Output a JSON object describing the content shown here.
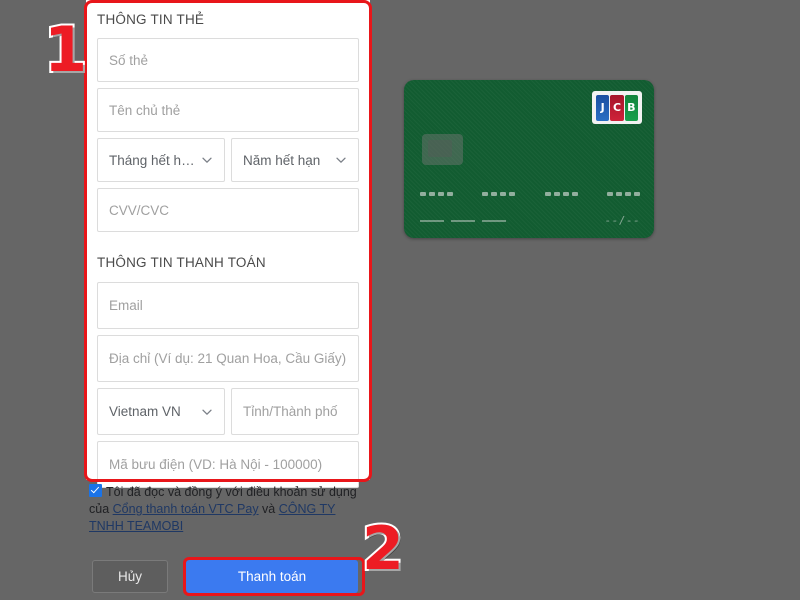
{
  "page": {
    "background_color": "#666666",
    "accent_blue": "#3b7af0",
    "annotation_red": "#e8161a"
  },
  "form": {
    "card_section_title": "THÔNG TIN THẺ",
    "payment_section_title": "THÔNG TIN THANH TOÁN",
    "card_number_placeholder": "Số thẻ",
    "card_holder_placeholder": "Tên chủ thẻ",
    "exp_month_label": "Tháng hết hạn",
    "exp_year_label": "Năm hết hạn",
    "cvv_placeholder": "CVV/CVC",
    "email_placeholder": "Email",
    "address_placeholder": "Địa chỉ (Ví dụ: 21 Quan Hoa, Cầu Giấy)",
    "country_label": "Vietnam VN",
    "city_placeholder": "Tỉnh/Thành phố",
    "postal_placeholder": "Mã bưu điện (VD: Hà Nội - 100000)"
  },
  "terms": {
    "text_before": "Tôi đã đọc và đồng ý với điều khoản sử dụng của ",
    "link1": "Cổng thanh toán VTC Pay",
    "conjunction": " và ",
    "link2": "CÔNG TY TNHH TEAMOBI",
    "checked": true
  },
  "buttons": {
    "cancel_label": "Hủy",
    "pay_label": "Thanh toán"
  },
  "annotations": {
    "step_one": "1",
    "step_two": "2"
  },
  "card_preview": {
    "brand": "JCB",
    "brand_letters": [
      "J",
      "C",
      "B"
    ],
    "expiry_placeholder": "--/--",
    "color": "#125c31"
  }
}
